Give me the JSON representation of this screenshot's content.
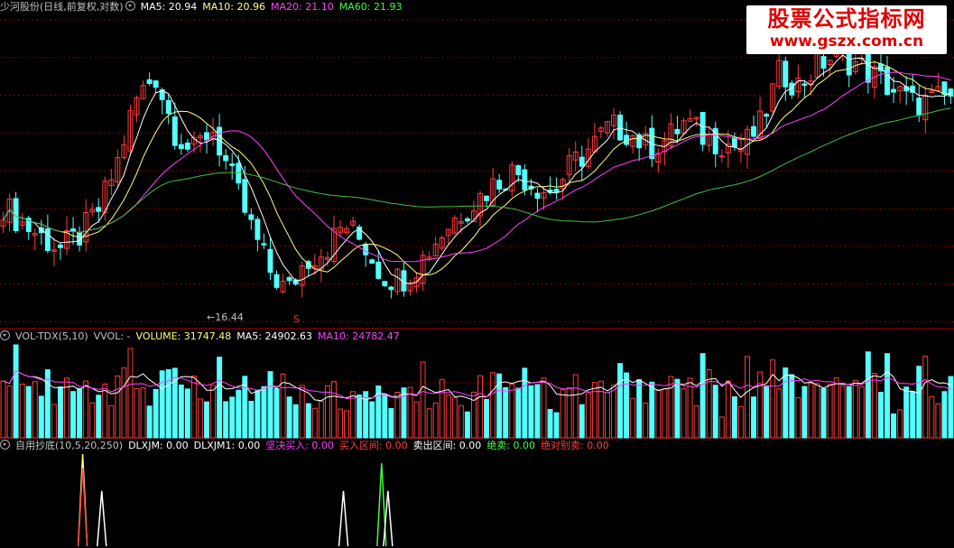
{
  "main_header": {
    "title": "少河股份(日线,前复权,对数)",
    "items": [
      {
        "label": "MA5: 20.94",
        "color": "#ffffff"
      },
      {
        "label": "MA10: 20.96",
        "color": "#ffff80"
      },
      {
        "label": "MA20: 21.10",
        "color": "#ff40ff"
      },
      {
        "label": "MA60: 21.93",
        "color": "#40ff40"
      }
    ]
  },
  "vol_header": {
    "title": "VOL-TDX(5,10)",
    "items": [
      {
        "label": "VVOL: -",
        "color": "#c0c0c0"
      },
      {
        "label": "VOLUME: 31747.48",
        "color": "#ffff80"
      },
      {
        "label": "MA5: 24902.63",
        "color": "#ffffff"
      },
      {
        "label": "MA10: 24782.47",
        "color": "#ff40ff"
      }
    ]
  },
  "ind_header": {
    "title": "自用抄底(10,5,20,250)",
    "items": [
      {
        "label": "DLXJM: 0.00",
        "color": "#ffffff"
      },
      {
        "label": "DLXJM1: 0.00",
        "color": "#ffffff"
      },
      {
        "label": "坚决买入: 0.00",
        "color": "#ff40ff"
      },
      {
        "label": "买入区间: 0.00",
        "color": "#ff4040"
      },
      {
        "label": "卖出区间: 0.00",
        "color": "#ffffff"
      },
      {
        "label": "绝卖: 0.00",
        "color": "#40ff40"
      },
      {
        "label": "绝对别卖: 0.00",
        "color": "#ff4040"
      }
    ]
  },
  "low_label": "16.44",
  "s_mark": "S",
  "watermark": {
    "line1": "股票公式指标网",
    "line2": "www.gszx.com.cn"
  },
  "colors": {
    "up": "#ff3c3c",
    "down": "#54ffff",
    "grid": "#8b0000",
    "ma5": "#ffffff",
    "ma10": "#ffff80",
    "ma20": "#ff40ff",
    "ma60": "#40c040"
  },
  "chart_data": {
    "type": "candlestick",
    "scale": "log",
    "y_range": [
      16.0,
      27.0
    ],
    "candles_sampled_close": [
      19.6,
      19.0,
      18.6,
      18.2,
      18.6,
      19.4,
      21.0,
      23.4,
      24.5,
      22.3,
      21.4,
      22.4,
      20.6,
      19.0,
      17.6,
      16.9,
      17.9,
      18.2,
      19.0,
      18.4,
      17.4,
      17.3,
      17.8,
      18.6,
      19.3,
      19.8,
      20.4,
      20.8,
      20.3,
      20.0,
      21.0,
      21.6,
      22.4,
      22.2,
      21.6,
      21.9,
      22.6,
      22.0,
      21.8,
      21.6,
      22.5,
      24.6,
      24.0,
      24.9,
      25.3,
      24.9,
      24.4,
      23.8,
      23.3,
      23.4,
      23.6
    ],
    "ma_last": {
      "MA5": 20.94,
      "MA10": 20.96,
      "MA20": 21.1,
      "MA60": 21.93
    },
    "volume_last": 31747.48,
    "volume_ma": {
      "MA5": 24902.63,
      "MA10": 24782.47
    },
    "signal_spikes": [
      {
        "x_index": 13,
        "height": 1.0,
        "color": "#ffff80"
      },
      {
        "x_index": 13,
        "height": 0.85,
        "color": "#ff4040"
      },
      {
        "x_index": 16,
        "height": 0.6,
        "color": "#ffffff"
      },
      {
        "x_index": 54,
        "height": 0.6,
        "color": "#ffffff"
      },
      {
        "x_index": 60,
        "height": 0.9,
        "color": "#40ff40"
      },
      {
        "x_index": 61,
        "height": 0.6,
        "color": "#ffffff"
      }
    ]
  }
}
